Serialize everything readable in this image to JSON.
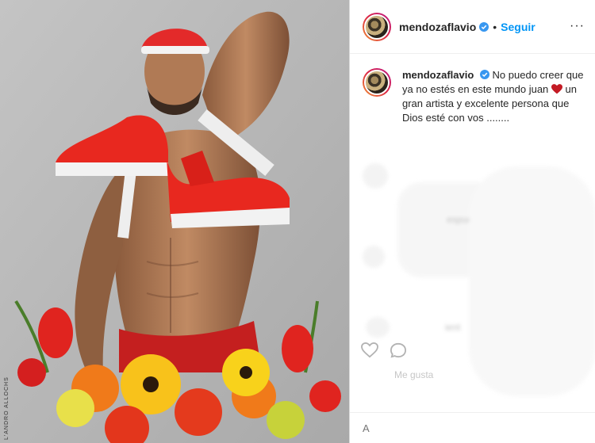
{
  "post": {
    "photo_credit": "L'ANDRO ALLOCHS",
    "header": {
      "username": "mendozaflavio",
      "separator": "•",
      "follow_label": "Seguir",
      "more_label": "···"
    },
    "caption": {
      "username": "mendozaflavio",
      "text_part1": "No puedo creer que ya no estés en este mundo juan",
      "text_part2": "un gran artista y excelente persona que Dios esté con vos ........"
    },
    "comments": {
      "partial_labels": [
        "espue",
        "7)",
        "ient",
        "Me gusta"
      ]
    },
    "composer": {
      "placeholder": "A"
    },
    "colors": {
      "accent": "#0095f6",
      "verified": "#3897f0",
      "heart": "#ed4956"
    }
  }
}
